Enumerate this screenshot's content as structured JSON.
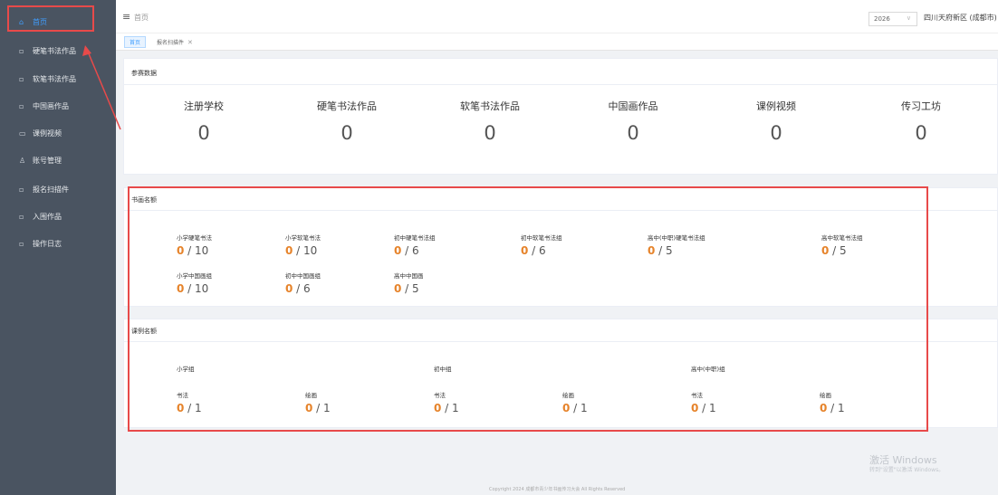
{
  "sidebar": {
    "items": [
      {
        "label": "首页",
        "icon": "home-icon",
        "glyph": "⌂",
        "active": true
      },
      {
        "label": "硬笔书法作品",
        "icon": "document-icon",
        "glyph": "▫"
      },
      {
        "label": "软笔书法作品",
        "icon": "document-icon",
        "glyph": "▫"
      },
      {
        "label": "中国画作品",
        "icon": "document-icon",
        "glyph": "▫"
      },
      {
        "label": "课例视频",
        "icon": "video-icon",
        "glyph": "▭"
      },
      {
        "label": "账号管理",
        "icon": "user-icon",
        "glyph": "♙"
      },
      {
        "label": "报名扫描件",
        "icon": "document-icon",
        "glyph": "▫"
      },
      {
        "label": "入围作品",
        "icon": "document-icon",
        "glyph": "▫"
      },
      {
        "label": "操作日志",
        "icon": "document-icon",
        "glyph": "▫"
      }
    ]
  },
  "header": {
    "menu_glyph": "≡",
    "breadcrumb": "首页",
    "year": "2026",
    "year_arrow": "∨",
    "region": "四川天府新区 (成都市)"
  },
  "tags": {
    "items": [
      {
        "label": "首页"
      },
      {
        "label": "报名扫描件",
        "close": "✕"
      }
    ]
  },
  "stats": {
    "title": "参赛数据",
    "items": [
      {
        "label": "注册学校",
        "value": "0"
      },
      {
        "label": "硬笔书法作品",
        "value": "0"
      },
      {
        "label": "软笔书法作品",
        "value": "0"
      },
      {
        "label": "中国画作品",
        "value": "0"
      },
      {
        "label": "课例视频",
        "value": "0"
      },
      {
        "label": "传习工坊",
        "value": "0"
      }
    ]
  },
  "calligraphy_quota": {
    "title": "书画名额",
    "items": [
      {
        "label": "小学硬笔书法",
        "current": "0",
        "total": "10"
      },
      {
        "label": "小学软笔书法",
        "current": "0",
        "total": "10"
      },
      {
        "label": "初中硬笔书法组",
        "current": "0",
        "total": "6"
      },
      {
        "label": "初中软笔书法组",
        "current": "0",
        "total": "6"
      },
      {
        "label": "高中(中职)硬笔书法组",
        "current": "0",
        "total": "5"
      },
      {
        "label": "高中软笔书法组",
        "current": "0",
        "total": "5"
      },
      {
        "label": "小学中国画组",
        "current": "0",
        "total": "10"
      },
      {
        "label": "初中中国画组",
        "current": "0",
        "total": "6"
      },
      {
        "label": "高中中国画",
        "current": "0",
        "total": "5"
      }
    ]
  },
  "lesson_quota": {
    "title": "课例名额",
    "groups": [
      {
        "label": "小学组",
        "items": [
          {
            "label": "书法",
            "current": "0",
            "total": "1"
          },
          {
            "label": "绘画",
            "current": "0",
            "total": "1"
          }
        ]
      },
      {
        "label": "初中组",
        "items": [
          {
            "label": "书法",
            "current": "0",
            "total": "1"
          },
          {
            "label": "绘画",
            "current": "0",
            "total": "1"
          }
        ]
      },
      {
        "label": "高中(中职)组",
        "items": [
          {
            "label": "书法",
            "current": "0",
            "total": "1"
          },
          {
            "label": "绘画",
            "current": "0",
            "total": "1"
          }
        ]
      }
    ]
  },
  "footer": {
    "text": "Copyright 2024 成都市青少年书画传习大会 All Rights Reserved"
  },
  "watermark": {
    "line1": "激活 Windows",
    "line2": "转到\"设置\"以激活 Windows。"
  },
  "colors": {
    "sidebar_bg": "#4a5461",
    "accent": "#409eff",
    "quota_current": "#e6832a",
    "annotation_red": "#e84a4a"
  }
}
